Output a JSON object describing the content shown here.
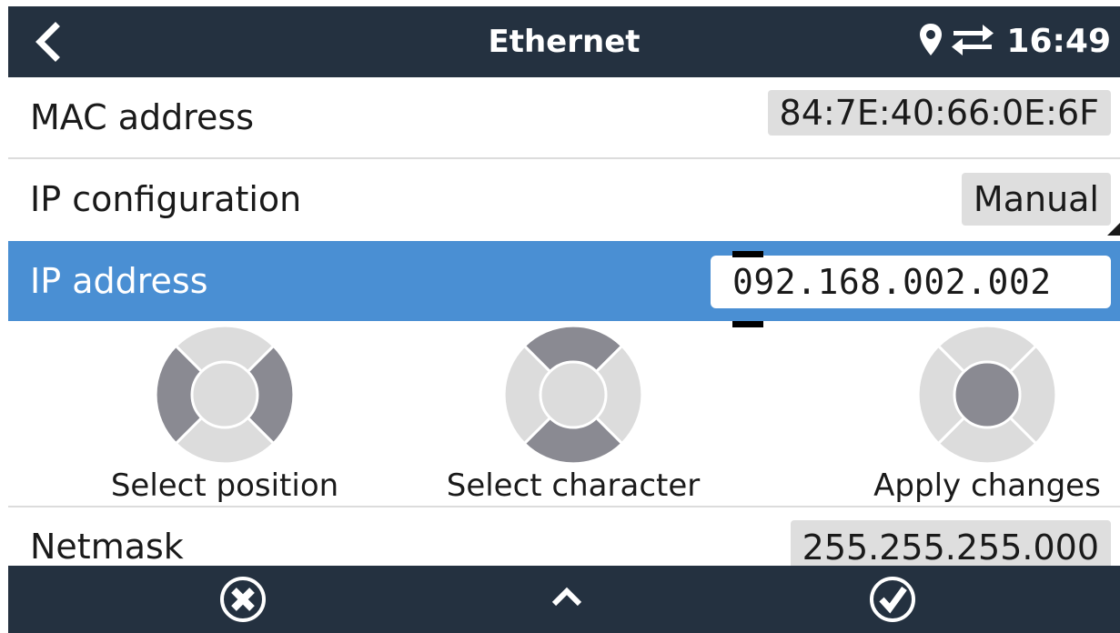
{
  "header": {
    "title": "Ethernet",
    "time": "16:49"
  },
  "settings": {
    "mac": {
      "label": "MAC address",
      "value": "84:7E:40:66:0E:6F"
    },
    "ip_config": {
      "label": "IP configuration",
      "value": "Manual"
    },
    "ip_address": {
      "label": "IP address",
      "value": "092.168.002.002"
    },
    "netmask": {
      "label": "Netmask",
      "value": "255.255.255.000"
    }
  },
  "help": {
    "select_position": "Select position",
    "select_character": "Select character",
    "apply_changes": "Apply changes"
  },
  "colors": {
    "header_bg": "#243140",
    "selected_row": "#4a8fd3",
    "value_box": "#dedede",
    "joystick_light": "#dcdcdc",
    "joystick_dark": "#8a8a92"
  },
  "icons": {
    "header": [
      "back-arrow-icon",
      "location-pin-icon",
      "transfer-arrows-icon"
    ],
    "footer": [
      "cancel-circle-icon",
      "chevron-up-icon",
      "check-circle-icon"
    ]
  }
}
